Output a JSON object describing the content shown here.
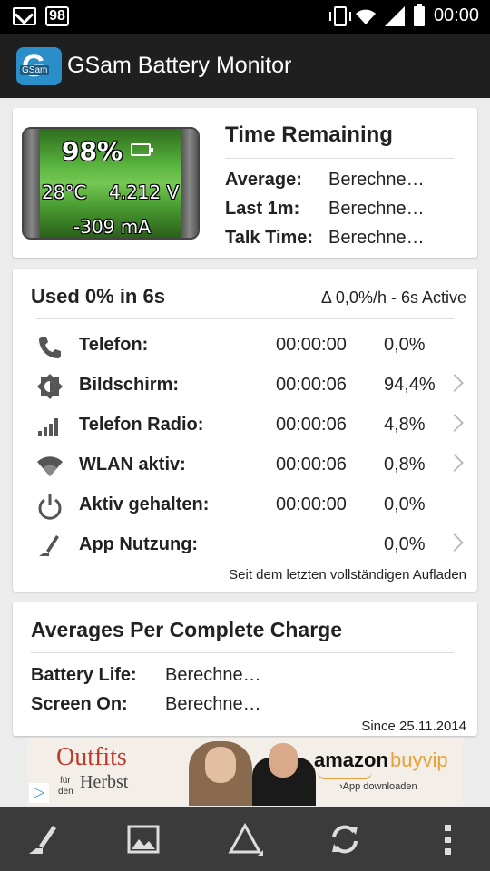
{
  "status_bar": {
    "notification_count": "98",
    "time": "00:00",
    "icons": [
      "mail-icon",
      "vibrate-icon",
      "wifi-icon",
      "signal-icon",
      "battery-icon"
    ]
  },
  "app": {
    "title": "GSam Battery Monitor",
    "logo_text": "GSam"
  },
  "battery": {
    "percent": "98%",
    "temperature": "28°C",
    "voltage": "4.212 V",
    "current": "-309 mA"
  },
  "time_remaining": {
    "title": "Time Remaining",
    "rows": [
      {
        "label": "Average:",
        "value": "Berechne…"
      },
      {
        "label": "Last 1m:",
        "value": "Berechne…"
      },
      {
        "label": "Talk Time:",
        "value": "Berechne…"
      }
    ]
  },
  "usage": {
    "title": "Used 0% in 6s",
    "summary": "Δ 0,0%/h - 6s Active",
    "rows": [
      {
        "icon": "phone-icon",
        "label": "Telefon:",
        "time": "00:00:00",
        "percent": "0,0%",
        "chevron": false
      },
      {
        "icon": "brightness-icon",
        "label": "Bildschirm:",
        "time": "00:00:06",
        "percent": "94,4%",
        "chevron": true
      },
      {
        "icon": "signal-bars-icon",
        "label": "Telefon Radio:",
        "time": "00:00:06",
        "percent": "4,8%",
        "chevron": true
      },
      {
        "icon": "wifi-icon",
        "label": "WLAN aktiv:",
        "time": "00:00:06",
        "percent": "0,8%",
        "chevron": true
      },
      {
        "icon": "power-icon",
        "label": "Aktiv gehalten:",
        "time": "00:00:00",
        "percent": "0,0%",
        "chevron": false
      },
      {
        "icon": "app-usage-icon",
        "label": "App Nutzung:",
        "time": "",
        "percent": "0,0%",
        "chevron": true
      }
    ],
    "footer": "Seit dem letzten vollständigen Aufladen"
  },
  "averages": {
    "title": "Averages Per Complete Charge",
    "rows": [
      {
        "label": "Battery Life:",
        "value": "Berechne…"
      },
      {
        "label": "Screen On:",
        "value": "Berechne…"
      }
    ],
    "footer": "Since 25.11.2014"
  },
  "ad": {
    "outfits": "Outfits",
    "fur": "für",
    "den": "den",
    "herbst": "Herbst",
    "amazon": "amazon",
    "buyvip": "buyvip",
    "download": "›App downloaden"
  },
  "bottom_bar": {
    "icons": [
      "app-usage-icon",
      "image-icon",
      "delta-icon",
      "refresh-icon",
      "more-vert-icon"
    ]
  }
}
